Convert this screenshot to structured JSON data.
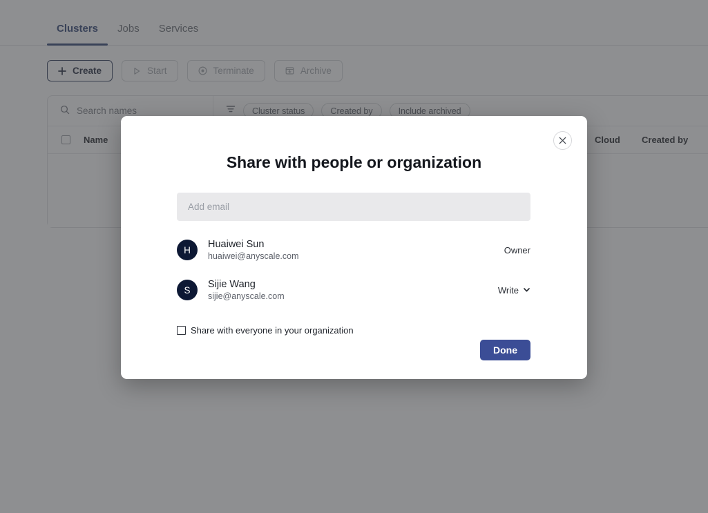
{
  "page": {
    "tabs": [
      {
        "label": "Clusters",
        "active": true
      },
      {
        "label": "Jobs",
        "active": false
      },
      {
        "label": "Services",
        "active": false
      }
    ],
    "toolbar": {
      "create_label": "Create",
      "start_label": "Start",
      "terminate_label": "Terminate",
      "archive_label": "Archive"
    },
    "search_placeholder": "Search names",
    "filters": [
      "Cluster status",
      "Created by",
      "Include archived"
    ],
    "table_headers": {
      "name": "Name",
      "cloud": "Cloud",
      "created_by": "Created by"
    }
  },
  "modal": {
    "title": "Share with people or organization",
    "email_placeholder": "Add email",
    "email_value": "",
    "people": [
      {
        "initial": "H",
        "name": "Huaiwei Sun",
        "email": "huaiwei@anyscale.com",
        "role": "Owner",
        "has_menu": false
      },
      {
        "initial": "S",
        "name": "Sijie Wang",
        "email": "sijie@anyscale.com",
        "role": "Write",
        "has_menu": true
      }
    ],
    "org_share_label": "Share with everyone in your organization",
    "org_share_checked": false,
    "done_label": "Done"
  },
  "colors": {
    "accent": "#21366b",
    "primary_button": "#3b4d96",
    "avatar": "#0d1834",
    "backdrop": "#7d7e80"
  }
}
